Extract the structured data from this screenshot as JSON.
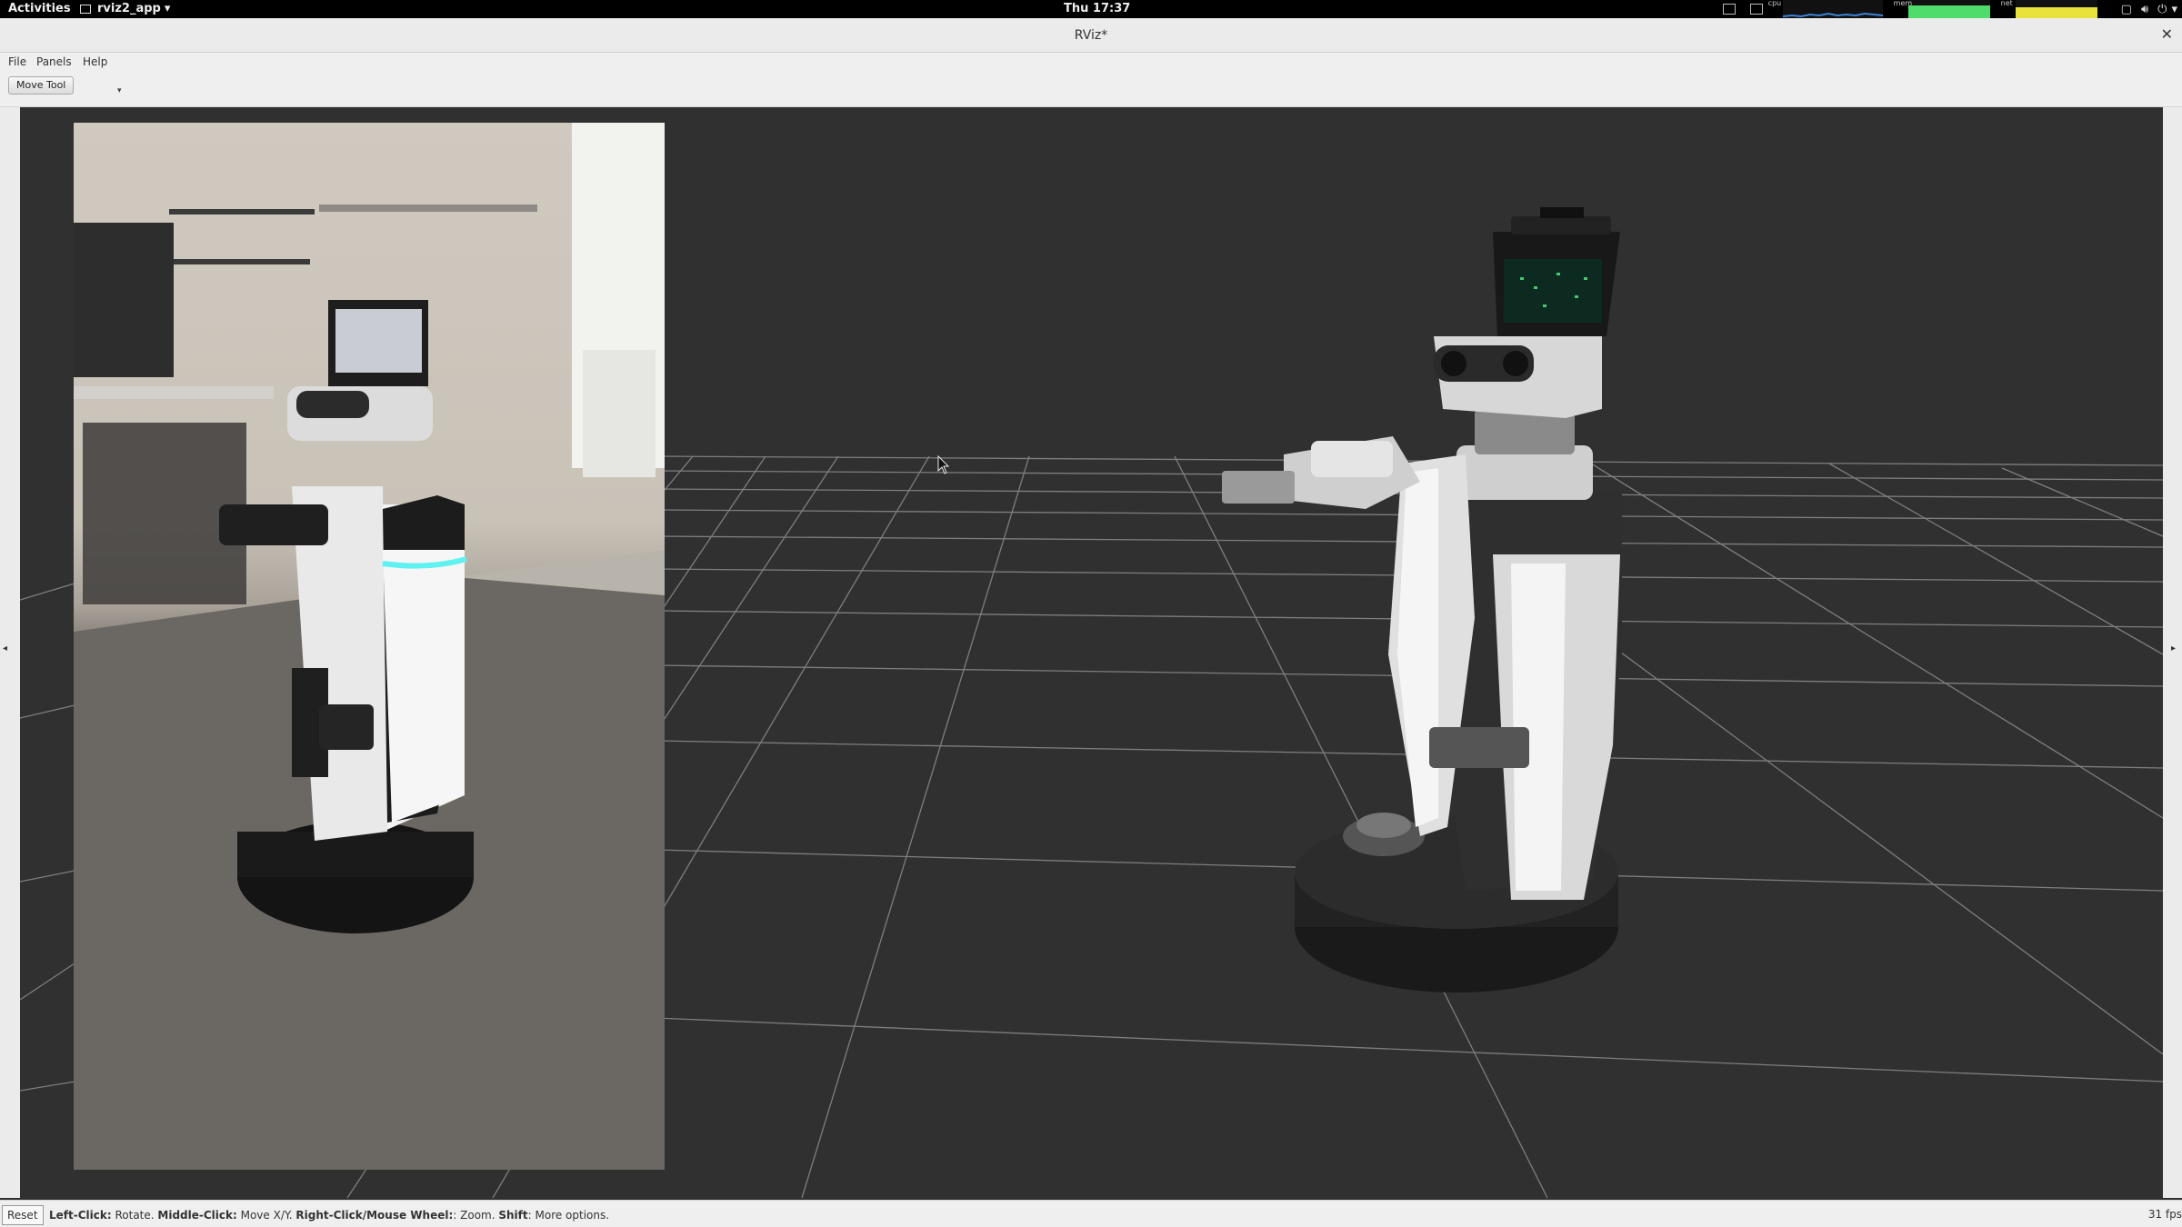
{
  "topbar": {
    "activities": "Activities",
    "app_name": "rviz2_app",
    "clock": "Thu 17:37",
    "monitors": {
      "cpu": "cpu",
      "mem": "mem",
      "net": "net"
    }
  },
  "window": {
    "title": "RViz*"
  },
  "menu": {
    "file": "File",
    "panels": "Panels",
    "help": "Help"
  },
  "toolbar": {
    "move_tool": "Move Tool"
  },
  "statusbar": {
    "reset": "Reset",
    "hint": {
      "left_click": "Left-Click:",
      "left_click_desc": " Rotate. ",
      "middle_click": "Middle-Click:",
      "middle_click_desc": " Move X/Y. ",
      "right_click": "Right-Click/Mouse Wheel:",
      "right_click_desc": ": Zoom. ",
      "shift": "Shift",
      "shift_desc": ": More options."
    },
    "fps": "31 fps"
  },
  "colors": {
    "viewport_bg": "#303030",
    "grid": "#8a8a8a",
    "accent_led": "#5ff2f0"
  },
  "icons": {
    "app_menu": "terminal-icon",
    "close": "close-icon",
    "cursor": "mouse-pointer-icon"
  }
}
